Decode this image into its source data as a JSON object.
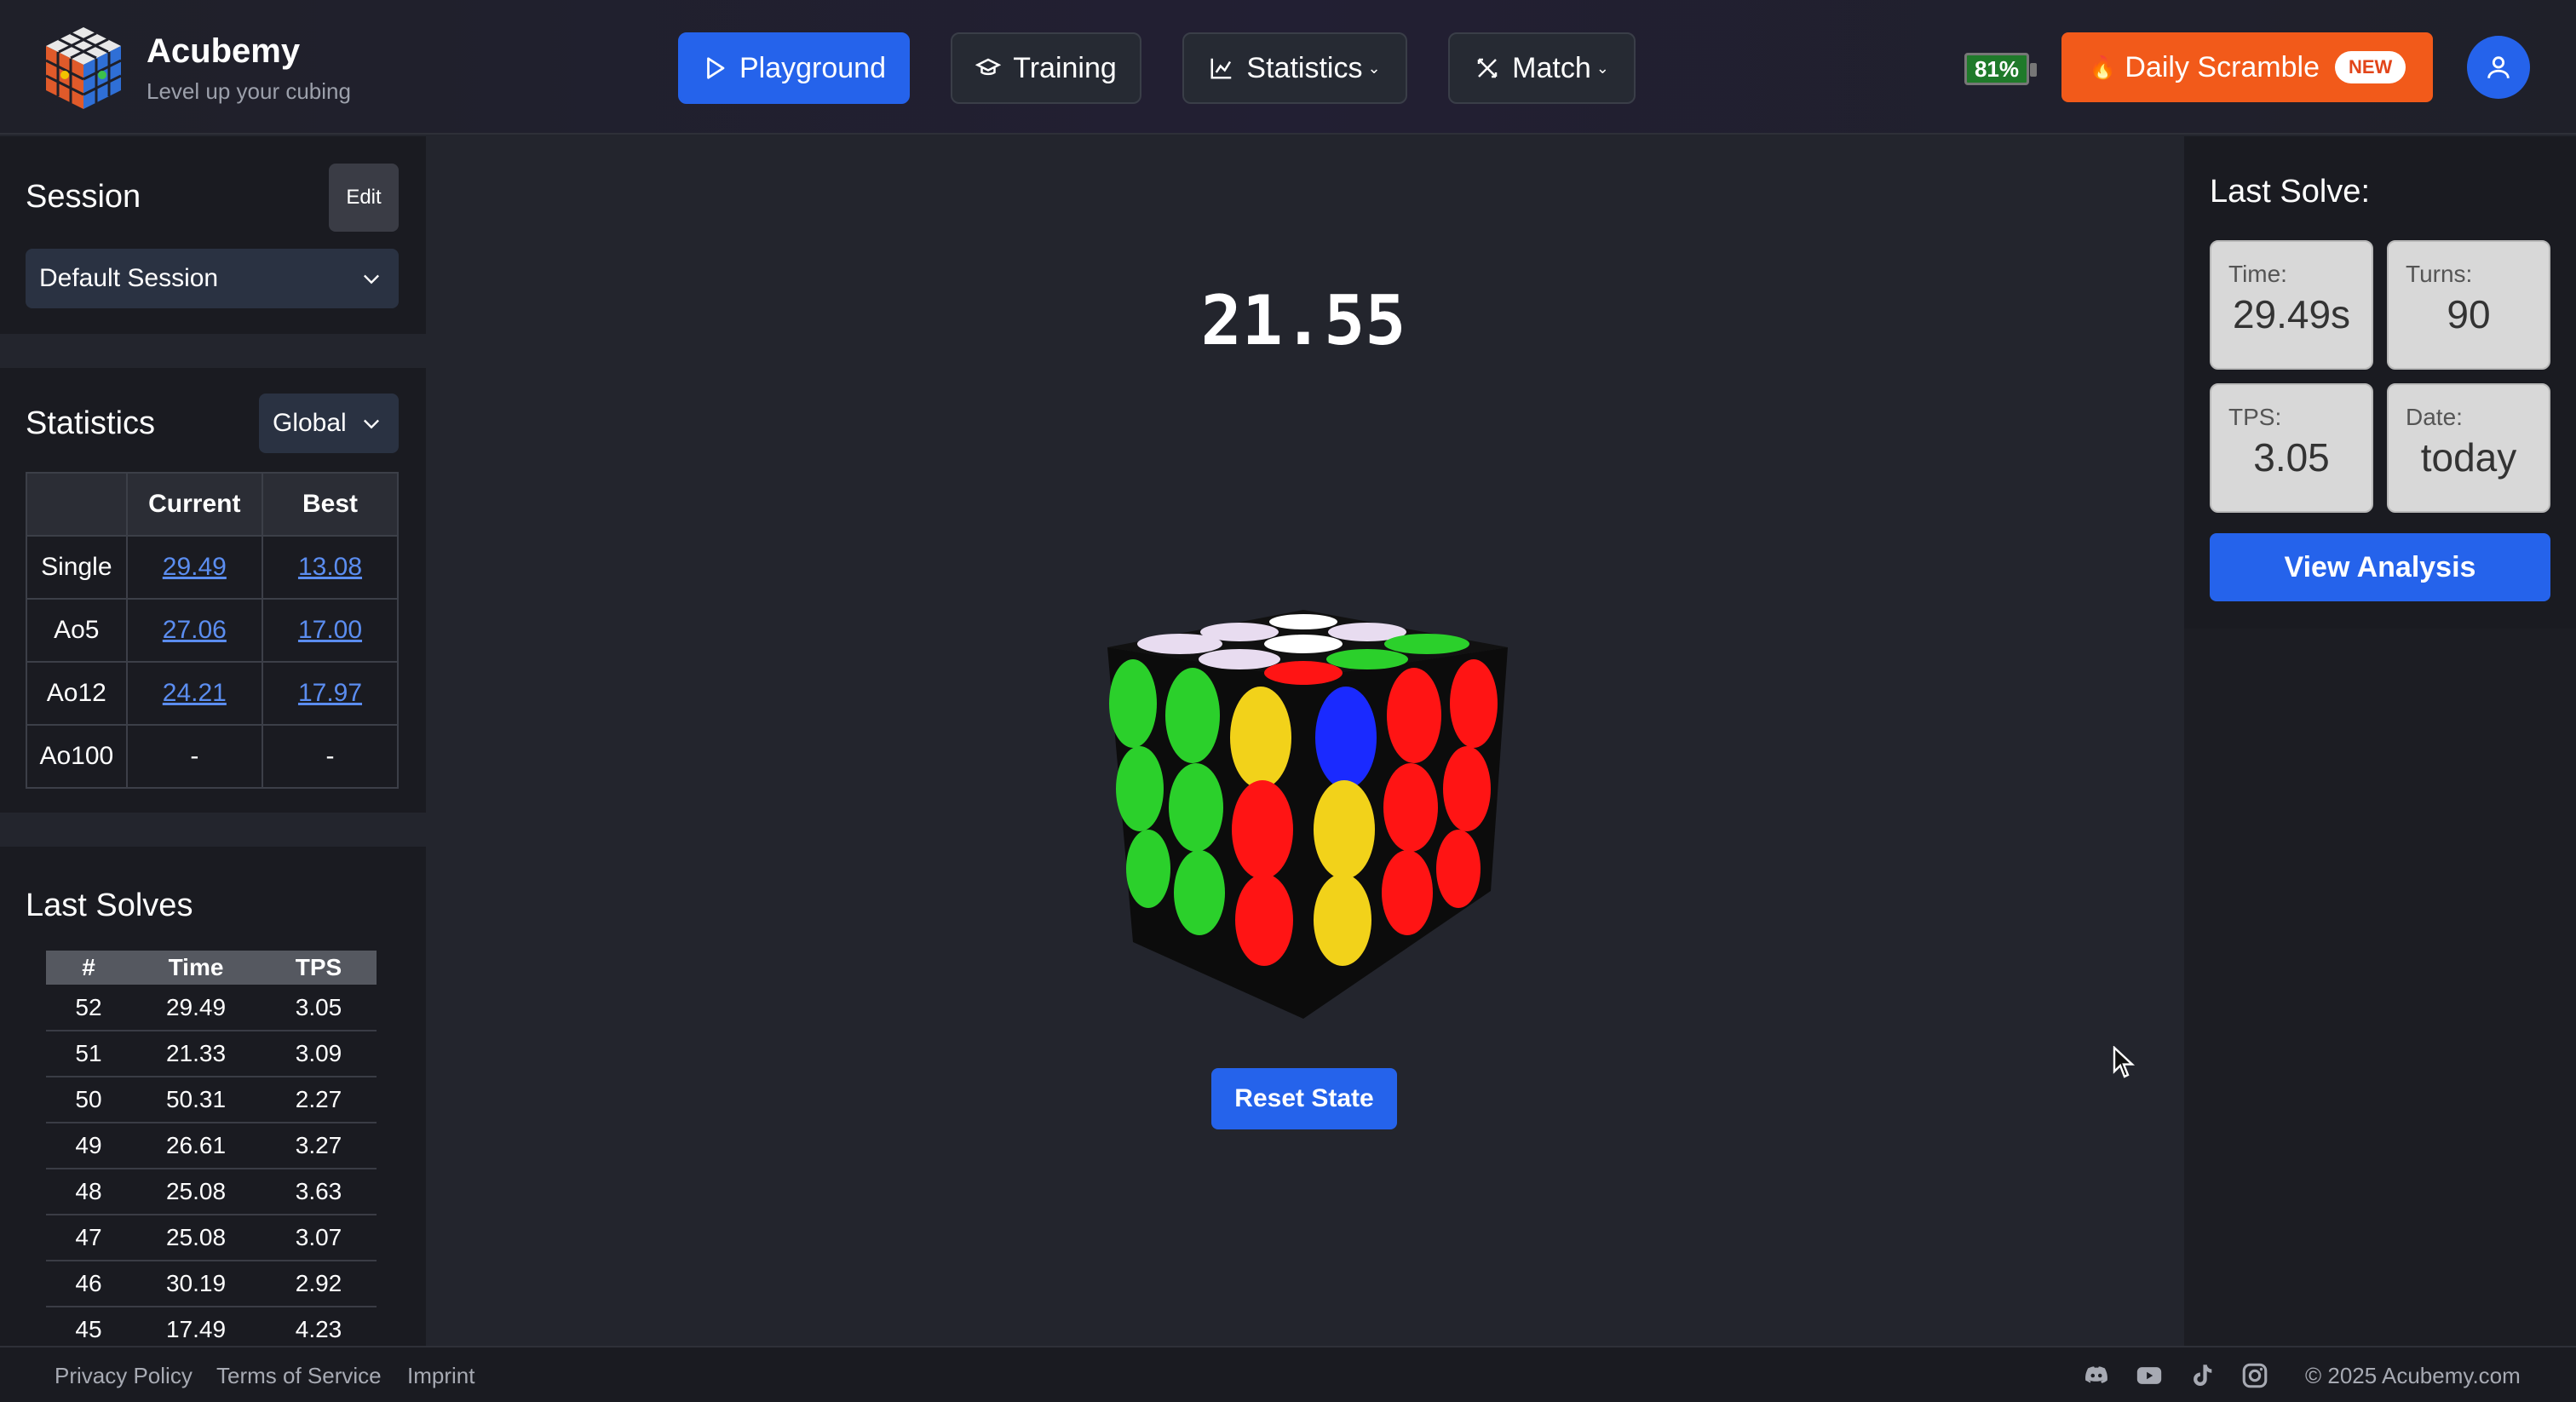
{
  "header": {
    "brand_name": "Acubemy",
    "tagline": "Level up your cubing",
    "nav": {
      "playground": "Playground",
      "training": "Training",
      "statistics": "Statistics",
      "match": "Match"
    },
    "battery": "81%",
    "daily_scramble": "Daily Scramble",
    "daily_emoji": "🔥",
    "new_badge": "NEW"
  },
  "session": {
    "title": "Session",
    "edit": "Edit",
    "selected": "Default Session"
  },
  "statistics": {
    "title": "Statistics",
    "scope": "Global",
    "columns": [
      "",
      "Current",
      "Best"
    ],
    "rows": [
      {
        "label": "Single",
        "current": "29.49",
        "best": "13.08"
      },
      {
        "label": "Ao5",
        "current": "27.06",
        "best": "17.00"
      },
      {
        "label": "Ao12",
        "current": "24.21",
        "best": "17.97"
      },
      {
        "label": "Ao100",
        "current": "-",
        "best": "-"
      }
    ]
  },
  "last_solves": {
    "title": "Last Solves",
    "columns": [
      "#",
      "Time",
      "TPS"
    ],
    "rows": [
      {
        "n": "52",
        "time": "29.49",
        "tps": "3.05"
      },
      {
        "n": "51",
        "time": "21.33",
        "tps": "3.09"
      },
      {
        "n": "50",
        "time": "50.31",
        "tps": "2.27"
      },
      {
        "n": "49",
        "time": "26.61",
        "tps": "3.27"
      },
      {
        "n": "48",
        "time": "25.08",
        "tps": "3.63"
      },
      {
        "n": "47",
        "time": "25.08",
        "tps": "3.07"
      },
      {
        "n": "46",
        "time": "30.19",
        "tps": "2.92"
      },
      {
        "n": "45",
        "time": "17.49",
        "tps": "4.23"
      }
    ]
  },
  "main": {
    "timer": "21.55",
    "reset_button": "Reset State"
  },
  "last_solve": {
    "title": "Last Solve:",
    "time_label": "Time:",
    "time_value": "29.49s",
    "turns_label": "Turns:",
    "turns_value": "90",
    "tps_label": "TPS:",
    "tps_value": "3.05",
    "date_label": "Date:",
    "date_value": "today",
    "view_button": "View Analysis"
  },
  "footer": {
    "privacy": "Privacy Policy",
    "terms": "Terms of Service",
    "imprint": "Imprint",
    "copyright": "© 2025 Acubemy.com"
  },
  "colors": {
    "accent": "#2563eb",
    "daily": "#f25a1a",
    "link": "#5b8df0",
    "battery": "#1f7a2a"
  },
  "icons": [
    "logo-cube-icon",
    "play-icon",
    "graduation-cap-icon",
    "chart-icon",
    "swords-icon",
    "user-icon",
    "chevron-down-icon",
    "discord-icon",
    "youtube-icon",
    "tiktok-icon",
    "instagram-icon"
  ]
}
